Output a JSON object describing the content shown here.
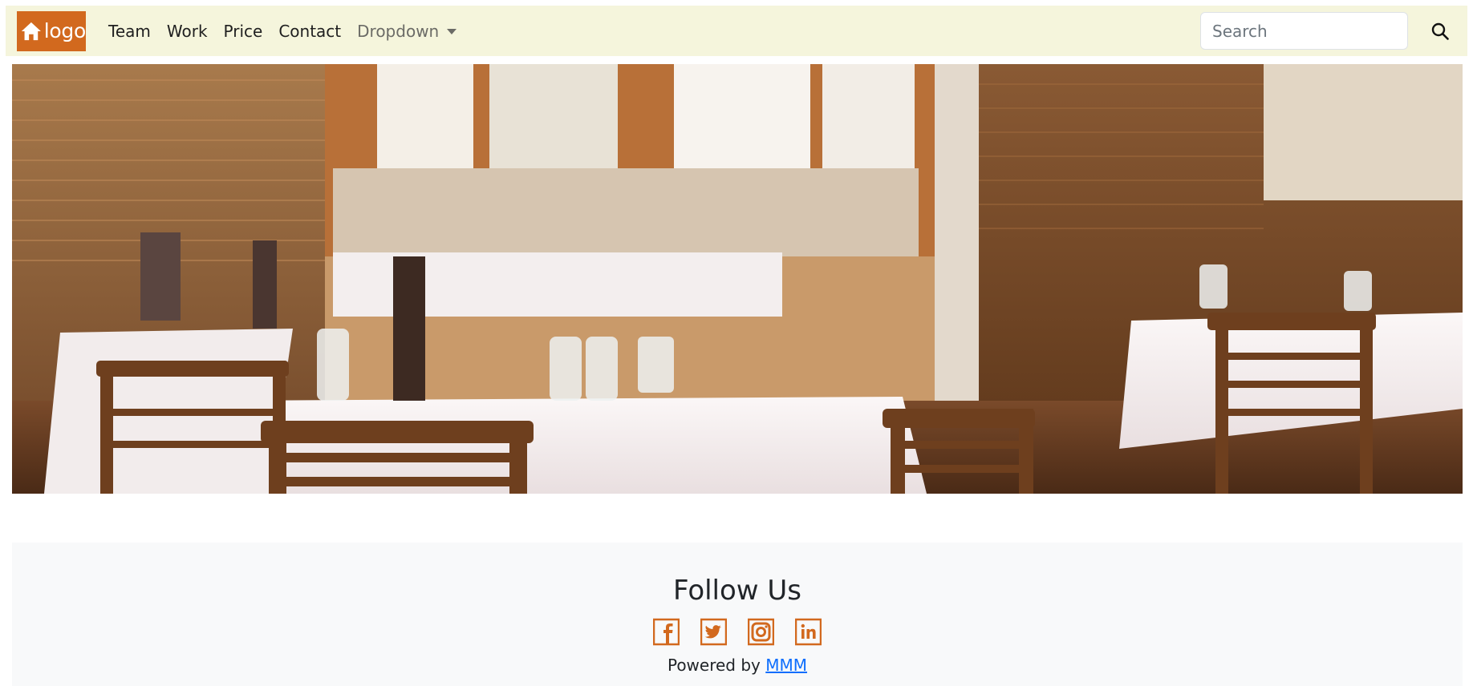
{
  "navbar": {
    "brand_text": "logo",
    "brand_icon": "home-icon",
    "links": [
      "Team",
      "Work",
      "Price",
      "Contact"
    ],
    "dropdown_label": "Dropdown",
    "search": {
      "placeholder": "Search",
      "value": ""
    },
    "search_icon": "search-icon",
    "colors": {
      "navbar_bg": "#f5f5dc",
      "brand_bg": "#d2691e"
    }
  },
  "hero": {
    "description_icon": "restaurant-photo"
  },
  "footer": {
    "heading": "Follow Us",
    "social_icons": [
      "facebook-icon",
      "twitter-icon",
      "instagram-icon",
      "linkedin-icon"
    ],
    "powered_prefix": "Powered by",
    "powered_link": "MMM",
    "colors": {
      "icon": "#d2691e",
      "link": "#0d6efd"
    }
  }
}
